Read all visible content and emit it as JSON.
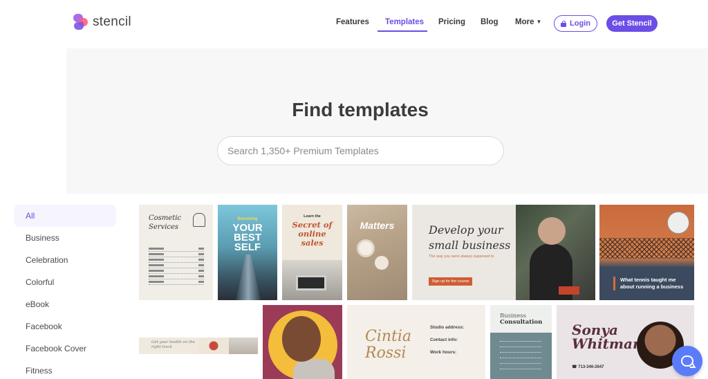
{
  "brand": {
    "name": "stencil"
  },
  "nav": {
    "items": [
      {
        "label": "Features"
      },
      {
        "label": "Templates"
      },
      {
        "label": "Pricing"
      },
      {
        "label": "Blog"
      },
      {
        "label": "More"
      }
    ],
    "active": "Templates",
    "login_label": "Login",
    "cta_label": "Get Stencil"
  },
  "hero": {
    "title": "Find templates",
    "search_placeholder": "Search 1,350+ Premium Templates"
  },
  "sidebar": {
    "categories": [
      "All",
      "Business",
      "Celebration",
      "Colorful",
      "eBook",
      "Facebook",
      "Facebook Cover",
      "Fitness"
    ],
    "active": "All"
  },
  "templates": [
    {
      "title": "Cosmetic Services"
    },
    {
      "kicker": "Becoming",
      "title": "YOUR BEST SELF"
    },
    {
      "kicker": "Learn the",
      "title": "Secret of online sales"
    },
    {
      "title": "Matters"
    },
    {
      "title": "Develop your small business",
      "tagline": "The way you were always supposed to",
      "button": "Sign up for the course"
    },
    {
      "title": "What tennis taught me about running a business"
    },
    {
      "title": "Get your health on the right track"
    },
    {
      "title": "Cintia Rossi",
      "lines": [
        "Studio address:",
        "Contact info:",
        "Work hours:"
      ]
    },
    {
      "title_top": "Business",
      "title_bottom": "Consultation"
    },
    {
      "title": "Sonya Whitman",
      "phone": "713-346-2647"
    }
  ],
  "colors": {
    "accent": "#6c4de6",
    "chat": "#5b7cfa"
  },
  "icons": {
    "lock": "lock-icon",
    "caret": "caret-down-icon",
    "chat": "chat-bubble-icon"
  }
}
